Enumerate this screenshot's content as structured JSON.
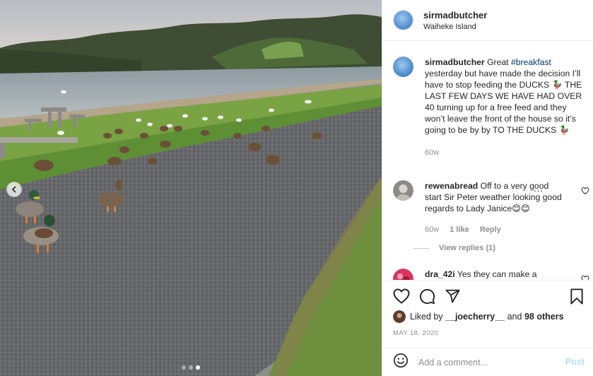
{
  "post": {
    "author": "sirmadbutcher",
    "location": "Waiheke Island",
    "carousel": {
      "slides": 3,
      "active": 2
    }
  },
  "caption": {
    "username": "sirmadbutcher",
    "pre_tag": "Great ",
    "hashtag": "#breakfast",
    "text": " yesterday but have made the decision I’ll have to stop feeding the DUCKS 🦆 THE LAST FEW DAYS WE HAVE HAD OVER 40 turning up for a free feed and they won’t leave the front of the house so it’s going to be by by TO THE DUCKS 🦆",
    "age": "60w"
  },
  "comments": [
    {
      "username": "rewenabread",
      "text": "Off to a very good start Sir Peter weather looking good regards to Lady Janice😊😊",
      "age": "60w",
      "likes": "1 like",
      "reply_label": "Reply",
      "more": "...",
      "view_replies": "View replies (1)",
      "avatar_color": "#8a8a88"
    },
    {
      "username": "dra_42i",
      "text": "Yes they can make a",
      "avatar_color": "#d8345f"
    }
  ],
  "actions": {
    "like_icon": "heart-icon",
    "comment_icon": "comment-bubble-icon",
    "share_icon": "paper-plane-icon",
    "save_icon": "bookmark-icon"
  },
  "likes": {
    "prefix": "Liked by ",
    "user": "__joecherry__",
    "middle": " and ",
    "others": "98 others"
  },
  "date": "MAY 18, 2020",
  "comment_box": {
    "placeholder": "Add a comment...",
    "post_label": "Post"
  },
  "colors": {
    "link_blue": "#00376b",
    "post_disabled": "#b2dffc",
    "muted": "#8e8e8e"
  }
}
